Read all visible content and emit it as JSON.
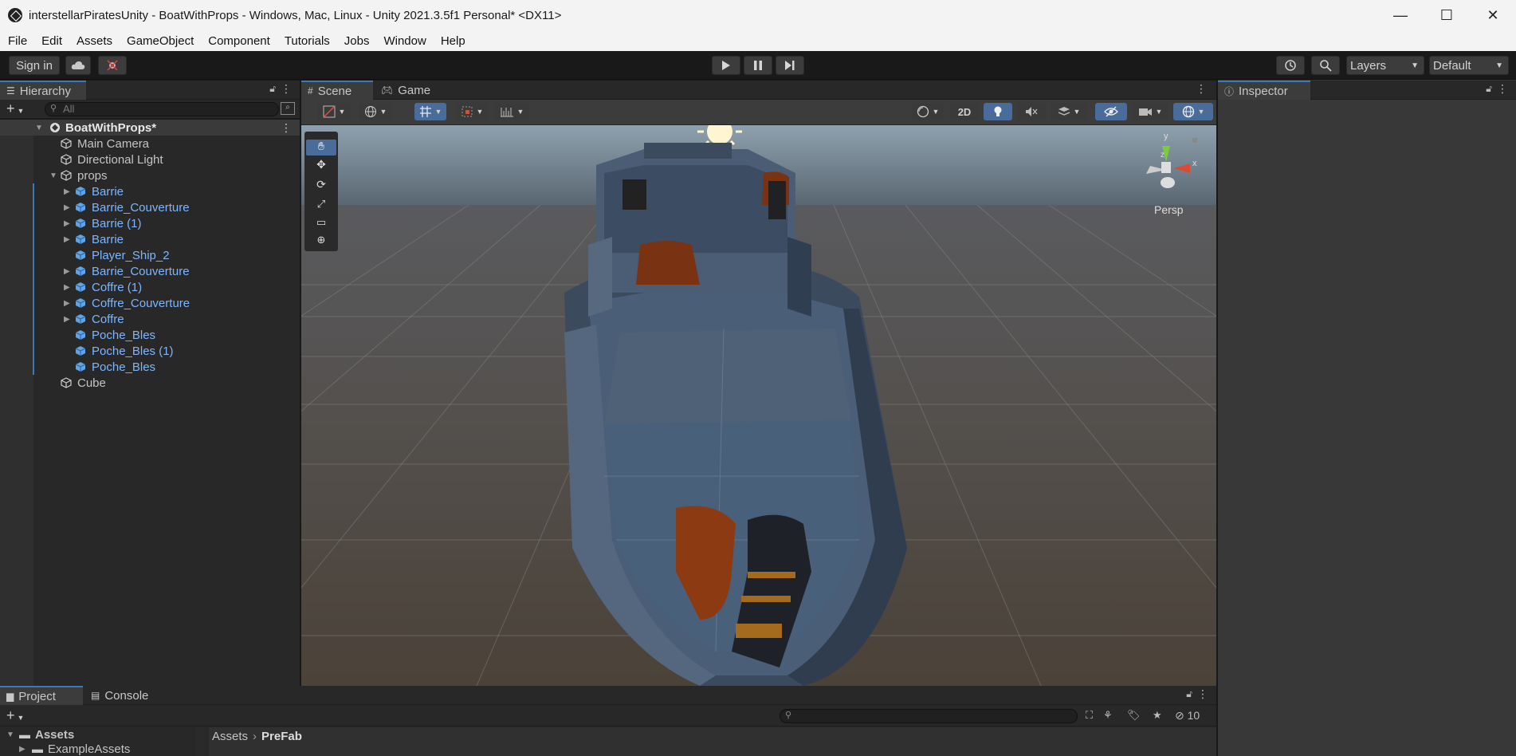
{
  "window": {
    "title": "interstellarPiratesUnity - BoatWithProps - Windows, Mac, Linux - Unity 2021.3.5f1 Personal* <DX11>",
    "minimize": "—",
    "maximize": "☐",
    "close": "✕"
  },
  "menu": [
    "File",
    "Edit",
    "Assets",
    "GameObject",
    "Component",
    "Tutorials",
    "Jobs",
    "Window",
    "Help"
  ],
  "toolbar": {
    "sign_in": "Sign in",
    "layers": "Layers",
    "layout": "Default"
  },
  "hierarchy": {
    "tab": "Hierarchy",
    "search_placeholder": "All",
    "scene_name": "BoatWithProps*",
    "items": [
      {
        "label": "Main Camera",
        "type": "object"
      },
      {
        "label": "Directional Light",
        "type": "object"
      },
      {
        "label": "props",
        "type": "object"
      },
      {
        "label": "Barrie",
        "type": "prefab"
      },
      {
        "label": "Barrie_Couverture",
        "type": "prefab"
      },
      {
        "label": "Barrie (1)",
        "type": "prefab"
      },
      {
        "label": "Barrie",
        "type": "prefab"
      },
      {
        "label": "Player_Ship_2",
        "type": "prefab"
      },
      {
        "label": "Barrie_Couverture",
        "type": "prefab"
      },
      {
        "label": "Coffre (1)",
        "type": "prefab"
      },
      {
        "label": "Coffre_Couverture",
        "type": "prefab"
      },
      {
        "label": "Coffre",
        "type": "prefab"
      },
      {
        "label": "Poche_Bles",
        "type": "prefab"
      },
      {
        "label": "Poche_Bles (1)",
        "type": "prefab"
      },
      {
        "label": "Poche_Bles",
        "type": "prefab"
      },
      {
        "label": "Cube",
        "type": "object"
      }
    ]
  },
  "scene_view": {
    "tab_scene": "Scene",
    "tab_game": "Game",
    "mode_2d": "2D",
    "persp": "Persp",
    "axis_y": "y",
    "axis_x": "x",
    "axis_z": "z"
  },
  "inspector": {
    "tab": "Inspector"
  },
  "bottom": {
    "tab_project": "Project",
    "tab_console": "Console",
    "assets_root": "Assets",
    "assets_child": "ExampleAssets",
    "breadcrumb_1": "Assets",
    "breadcrumb_2": "PreFab",
    "hidden_count": "10"
  },
  "colors": {
    "accent": "#3a79bb",
    "prefab_text": "#7bb6ff"
  }
}
